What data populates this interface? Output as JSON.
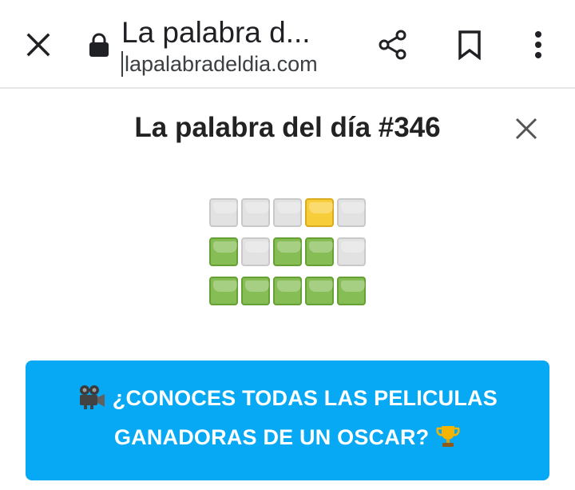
{
  "browser": {
    "page_title": "La palabra d...",
    "url": "lapalabradeldia.com",
    "icons": [
      "close-icon",
      "lock-icon",
      "share-icon",
      "bookmark-icon",
      "more-vert-icon"
    ]
  },
  "modal": {
    "title": "La palabra del día #346",
    "close_icon": "close-icon"
  },
  "result_grid": {
    "rows": [
      [
        "absent",
        "absent",
        "absent",
        "present",
        "absent"
      ],
      [
        "correct",
        "absent",
        "correct",
        "correct",
        "absent"
      ],
      [
        "correct",
        "correct",
        "correct",
        "correct",
        "correct"
      ]
    ],
    "colors": {
      "absent": "#e2e2e2",
      "present": "#f7cd3a",
      "correct": "#86bd55"
    }
  },
  "promo": {
    "line1": "¿CONOCES TODAS LAS PELICULAS",
    "line2": "GANADORAS DE UN OSCAR?",
    "leading_icon": "movie-camera-icon",
    "trailing_icon": "trophy-icon",
    "background": "#07a9f4"
  }
}
